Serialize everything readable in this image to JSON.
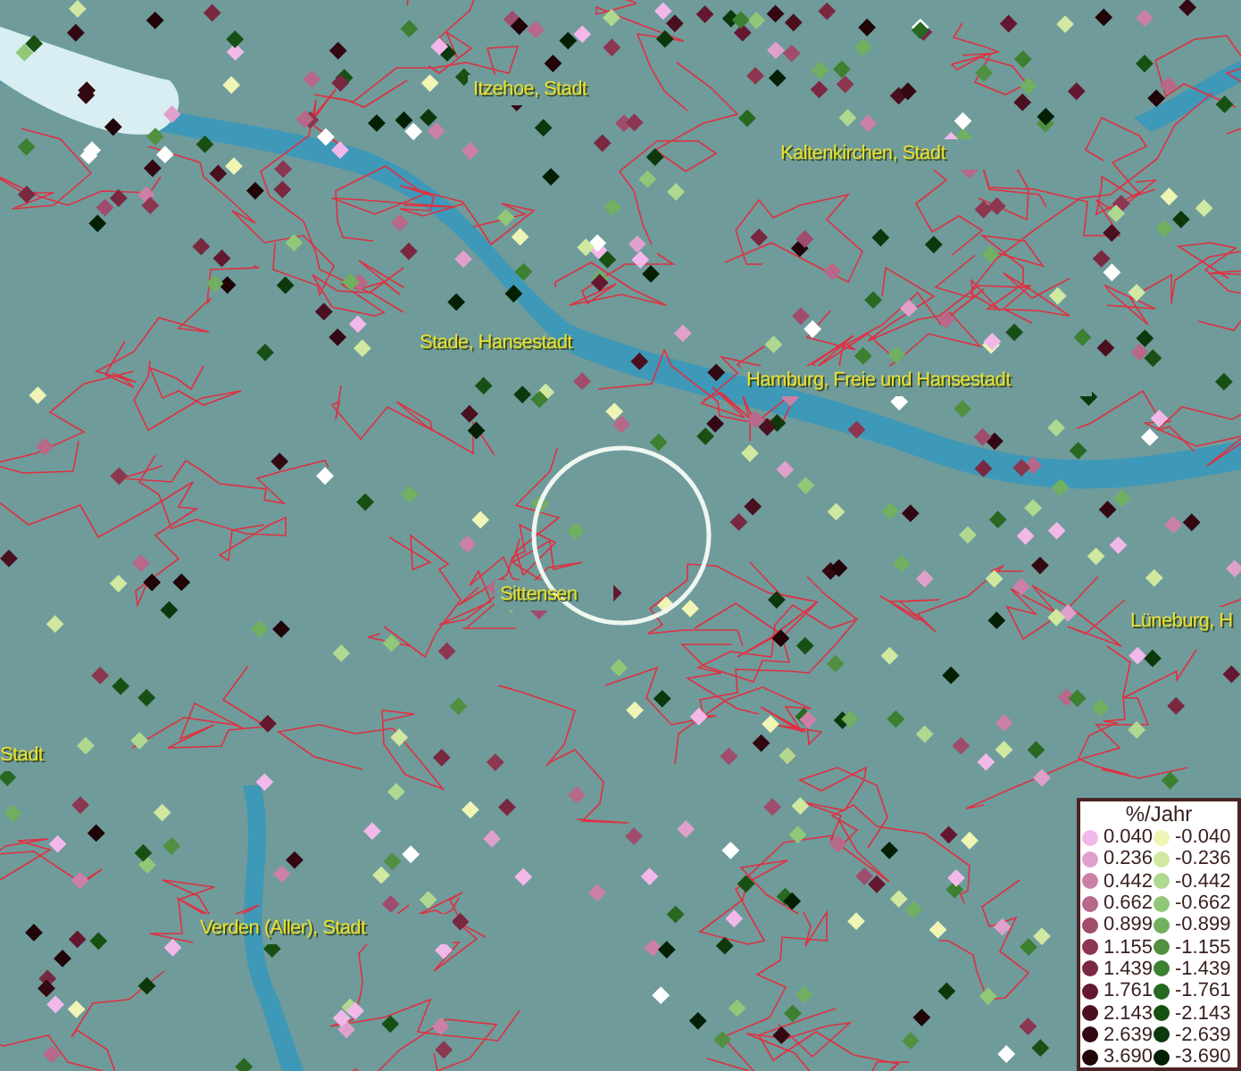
{
  "map": {
    "labels": [
      {
        "text": "Itzehoe, Stadt"
      },
      {
        "text": "Kaltenkirchen, Stadt"
      },
      {
        "text": "Stade, Hansestadt"
      },
      {
        "text": "Hamburg, Freie und Hansestadt"
      },
      {
        "text": "Sittensen"
      },
      {
        "text": "Lüneburg, H"
      },
      {
        "text": "Stadt"
      },
      {
        "text": "Verden (Aller), Stadt"
      }
    ]
  },
  "legend": {
    "title": "%/Jahr",
    "positive": [
      {
        "label": "0.040",
        "color": "#f3b8ea"
      },
      {
        "label": "0.236",
        "color": "#e0a0cc"
      },
      {
        "label": "0.442",
        "color": "#cc80a8"
      },
      {
        "label": "0.662",
        "color": "#b86888"
      },
      {
        "label": "0.899",
        "color": "#a04c6c"
      },
      {
        "label": "1.155",
        "color": "#8c3650"
      },
      {
        "label": "1.439",
        "color": "#7a2840"
      },
      {
        "label": "1.761",
        "color": "#641830"
      },
      {
        "label": "2.143",
        "color": "#4a1020"
      },
      {
        "label": "2.639",
        "color": "#340812"
      },
      {
        "label": "3.690",
        "color": "#200408"
      }
    ],
    "negative": [
      {
        "label": "-0.040",
        "color": "#f0f4b4"
      },
      {
        "label": "-0.236",
        "color": "#d0e8a0"
      },
      {
        "label": "-0.442",
        "color": "#b0d890"
      },
      {
        "label": "-0.662",
        "color": "#90c878"
      },
      {
        "label": "-0.899",
        "color": "#70b060"
      },
      {
        "label": "-1.155",
        "color": "#509040"
      },
      {
        "label": "-1.439",
        "color": "#3c8030"
      },
      {
        "label": "-1.761",
        "color": "#286820"
      },
      {
        "label": "-2.143",
        "color": "#185014"
      },
      {
        "label": "-2.639",
        "color": "#0c380c"
      },
      {
        "label": "-3.690",
        "color": "#042004"
      }
    ]
  }
}
